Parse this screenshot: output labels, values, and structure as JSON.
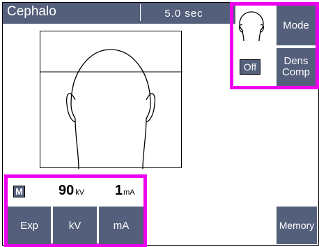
{
  "title_bar": {
    "mode_name": "Cephalo",
    "exposure_time": "5.0 sec"
  },
  "preview": {
    "description": ""
  },
  "mode_panel": {
    "head_icon": "head-outline-icon",
    "mode_button": "Mode",
    "off_indicator": "Off",
    "dens_comp_button": [
      "Dens",
      "Comp"
    ]
  },
  "exposure_panel": {
    "mode_letter": "M",
    "kv_value": "90",
    "kv_unit": "kV",
    "ma_value": "1",
    "ma_unit": "mA",
    "buttons": {
      "exp": "Exp",
      "kv": "kV",
      "ma": "mA"
    }
  },
  "memory_button": "Memory",
  "colors": {
    "button_bg": "#545f7b",
    "highlight": "#ee00ee",
    "background": "#ffffff"
  }
}
